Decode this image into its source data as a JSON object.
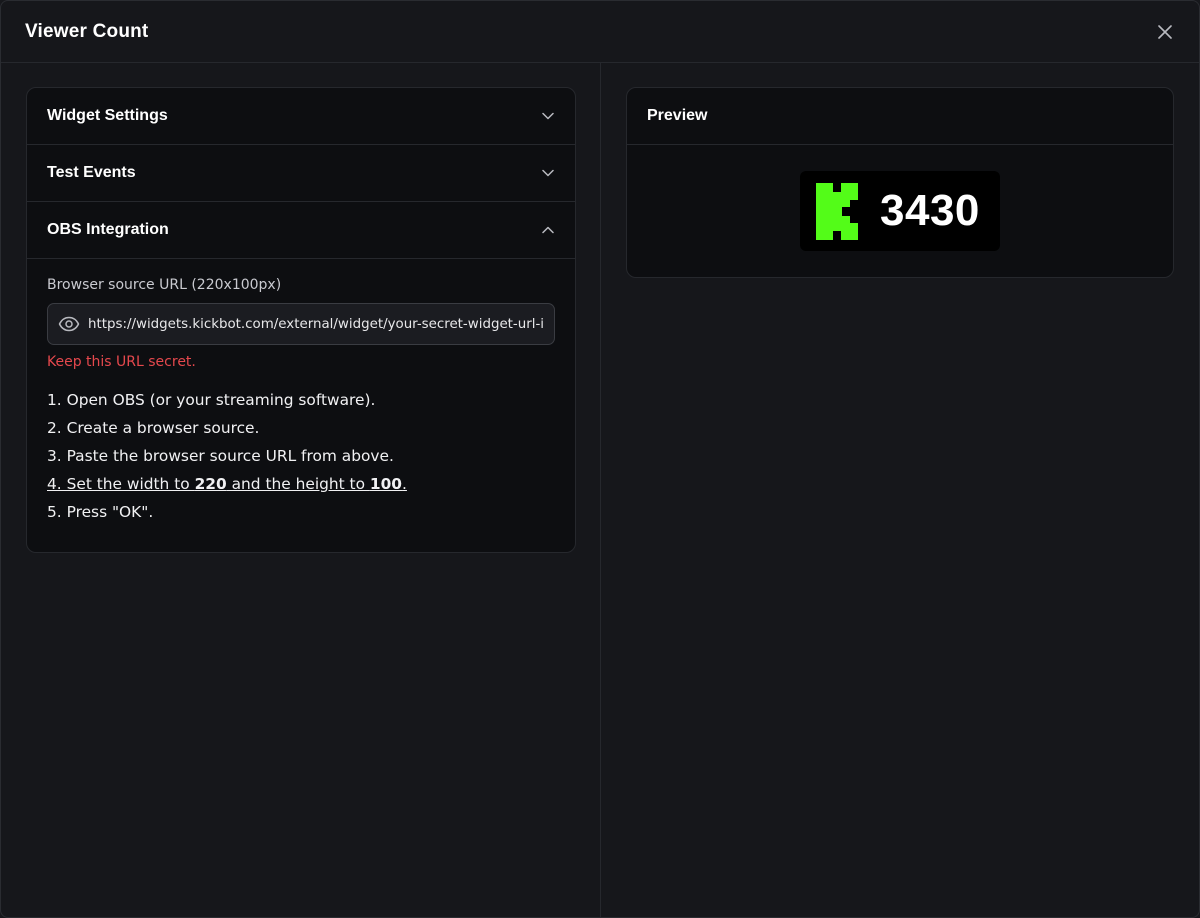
{
  "modal": {
    "title": "Viewer Count"
  },
  "accordion": {
    "widget_settings": {
      "label": "Widget Settings",
      "expanded": false
    },
    "test_events": {
      "label": "Test Events",
      "expanded": false
    },
    "obs_integration": {
      "label": "OBS Integration",
      "expanded": true
    }
  },
  "obs": {
    "url_label": "Browser source URL (220x100px)",
    "url_value": "https://widgets.kickbot.com/external/widget/your-secret-widget-url-id",
    "warning": "Keep this URL secret.",
    "steps": [
      "1. Open OBS (or your streaming software).",
      "2. Create a browser source.",
      "3. Paste the browser source URL from above.",
      "5. Press \"OK\"."
    ],
    "step4": {
      "prefix": "4. Set the width to ",
      "width": "220",
      "middle": " and the height to ",
      "height": "100",
      "suffix": "."
    }
  },
  "preview": {
    "label": "Preview",
    "viewer_count": "3430"
  },
  "icons": {
    "close": "close-icon",
    "chevron_down": "chevron-down-icon",
    "chevron_up": "chevron-up-icon",
    "eye": "eye-icon",
    "logo": "kick-logo"
  },
  "colors": {
    "background": "#16171b",
    "card": "#0d0e11",
    "border": "#26282d",
    "warning": "#e5484d",
    "kick_green": "#53fc18"
  }
}
